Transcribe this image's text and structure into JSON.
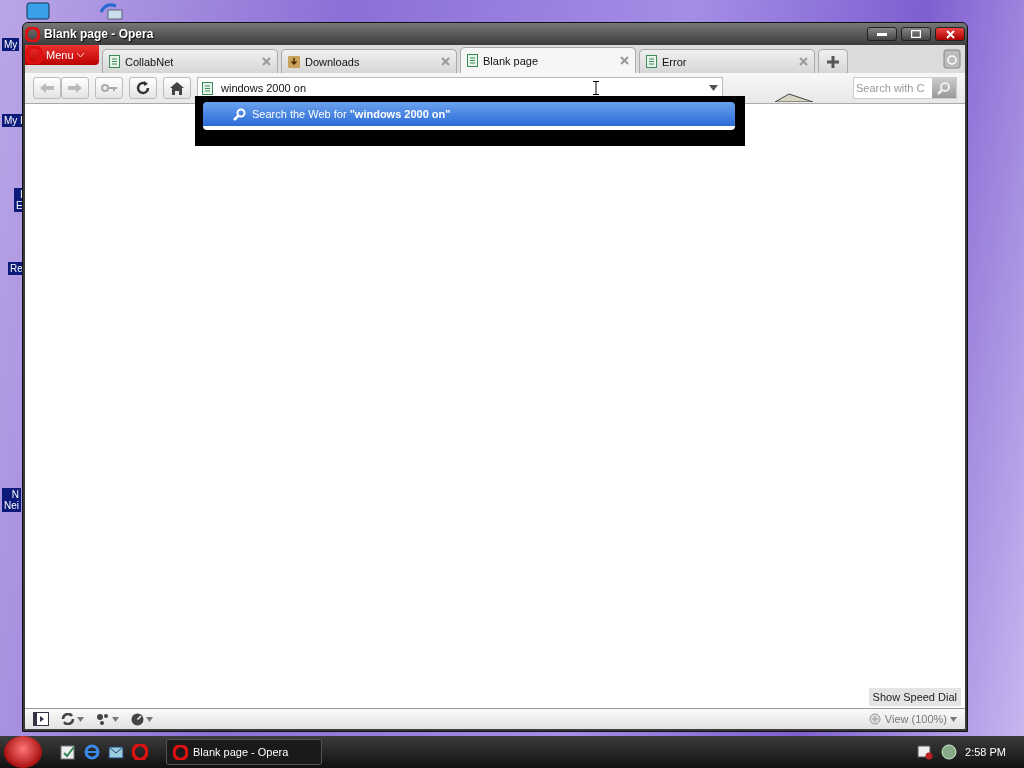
{
  "desktop": {
    "icon_labels": [
      {
        "lines": [
          "My"
        ]
      },
      {
        "lines": [
          "My I"
        ]
      },
      {
        "lines": [
          "I",
          "E"
        ]
      },
      {
        "lines": [
          "Re"
        ]
      },
      {
        "lines": [
          "N",
          "Nei"
        ]
      }
    ]
  },
  "window": {
    "title": "Blank page - Opera"
  },
  "menu_button": {
    "label": "Menu"
  },
  "tabs": [
    {
      "label": "CollabNet",
      "kind": "page",
      "selected": false
    },
    {
      "label": "Downloads",
      "kind": "downloads",
      "selected": false
    },
    {
      "label": "Blank page",
      "kind": "page",
      "selected": true
    },
    {
      "label": "Error",
      "kind": "page",
      "selected": false
    }
  ],
  "address_bar": {
    "value": "windows 2000 on"
  },
  "search_field": {
    "placeholder": "Search with C"
  },
  "suggestions": [
    {
      "prefix": "Search the Web for ",
      "query": "\"windows 2000 on\"",
      "selected": true
    }
  ],
  "speed_dial_button": {
    "label": "Show Speed Dial"
  },
  "status_bar": {
    "zoom": "View (100%)"
  },
  "taskbar": {
    "task": {
      "label": "Blank page - Opera",
      "selected": false
    },
    "clock": "2:58 PM"
  }
}
